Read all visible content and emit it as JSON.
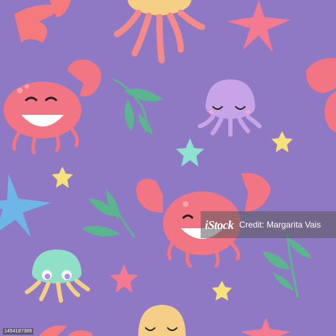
{
  "image": {
    "description_colors": {
      "background": "#8f78c4",
      "crab": "#f27583",
      "crab_dark": "#d9566a",
      "jelly_purple": "#c7a4e8",
      "jelly_teal": "#8fe0c6",
      "jelly_yellow": "#f7d08a",
      "starfish_blue": "#6db6e8",
      "starfish_pink": "#f47a92",
      "starfish_yellow": "#f8e17a",
      "star_mint": "#8de3cf",
      "seaweed": "#5bb58e"
    }
  },
  "watermark": {
    "logo_text": "iStock",
    "credit_text": "Credit: Margarita Vais"
  },
  "footer": {
    "id_text": "1454187369"
  }
}
